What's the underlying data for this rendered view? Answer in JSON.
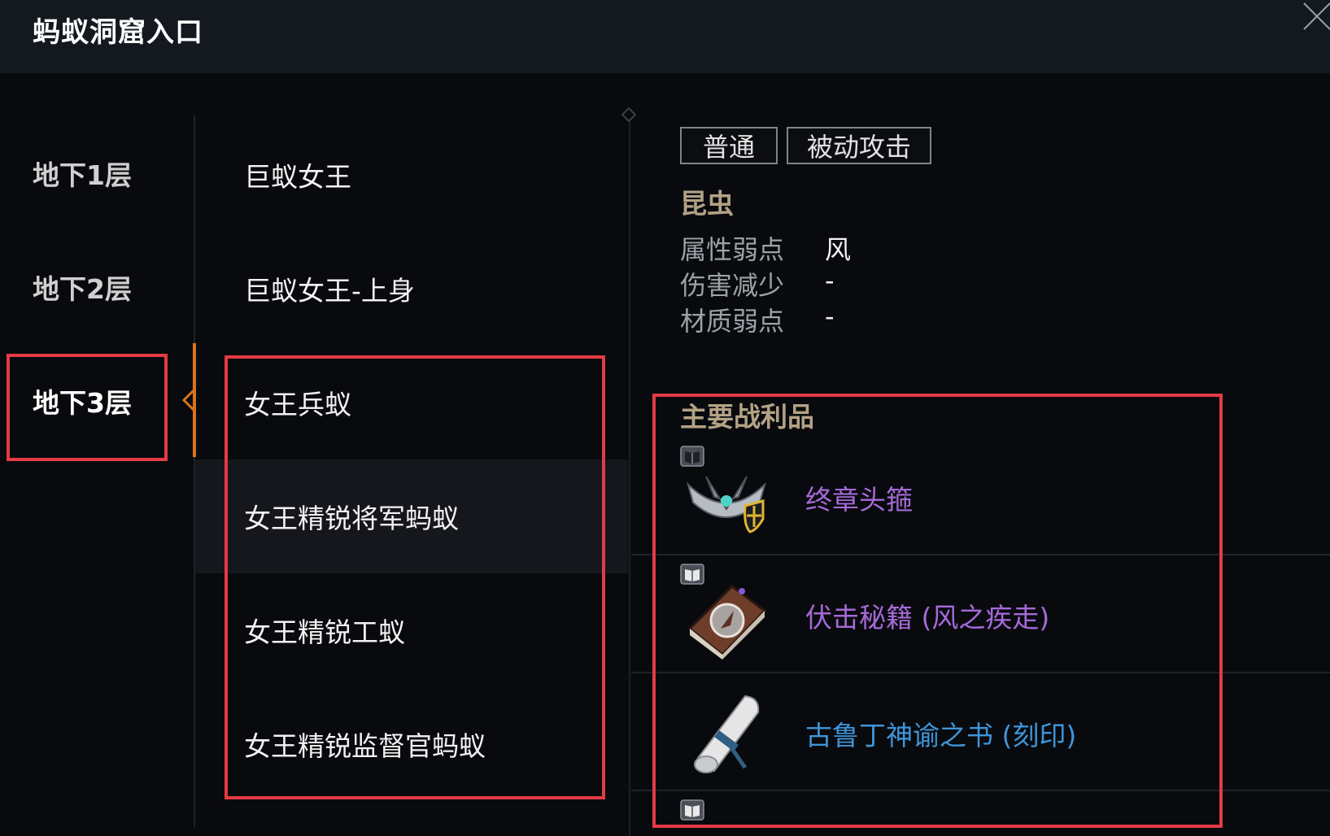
{
  "window": {
    "title": "蚂蚁洞窟入口"
  },
  "floors": [
    {
      "label": "地下1层",
      "active": false
    },
    {
      "label": "地下2层",
      "active": false
    },
    {
      "label": "地下3层",
      "active": true
    }
  ],
  "monsters": [
    {
      "label": "巨蚁女王"
    },
    {
      "label": "巨蚁女王-上身"
    },
    {
      "label": "女王兵蚁"
    },
    {
      "label": "女王精锐将军蚂蚁",
      "highlighted": true
    },
    {
      "label": "女王精锐工蚁"
    },
    {
      "label": "女王精锐监督官蚂蚁"
    }
  ],
  "detail": {
    "tags": [
      "普通",
      "被动攻击"
    ],
    "type": "昆虫",
    "attributes": [
      {
        "key": "属性弱点",
        "value": "风"
      },
      {
        "key": "伤害减少",
        "value": "-"
      },
      {
        "key": "材质弱点",
        "value": "-"
      }
    ],
    "loot_title": "主要战利品",
    "loot": [
      {
        "name": "终章头箍",
        "color": "#a56ad8",
        "icon": "circlet-icon"
      },
      {
        "name": "伏击秘籍 (风之疾走)",
        "color": "#a56ad8",
        "icon": "book-icon"
      },
      {
        "name": "古鲁丁神谕之书 (刻印)",
        "color": "#3e95d8",
        "icon": "scroll-icon"
      }
    ]
  },
  "colors": {
    "accent": "#d9741d",
    "epic": "#a56ad8",
    "rare": "#3e95d8",
    "annotation": "#e33b44"
  }
}
